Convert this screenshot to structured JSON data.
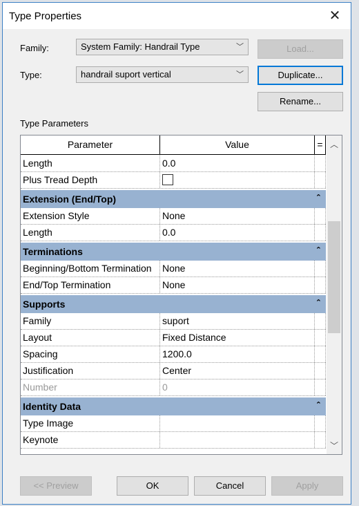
{
  "dialog": {
    "title": "Type Properties"
  },
  "family": {
    "label": "Family:",
    "value": "System Family: Handrail Type"
  },
  "type": {
    "label": "Type:",
    "value": "handrail suport vertical"
  },
  "buttons": {
    "load": "Load...",
    "duplicate": "Duplicate...",
    "rename": "Rename...",
    "preview": "<< Preview",
    "ok": "OK",
    "cancel": "Cancel",
    "apply": "Apply"
  },
  "section_label": "Type Parameters",
  "grid": {
    "headers": [
      "Parameter",
      "Value",
      "="
    ],
    "scroll_position_percent": 40,
    "rows": [
      {
        "kind": "row",
        "name": "Length",
        "value": "0.0"
      },
      {
        "kind": "row",
        "name": "Plus Tread Depth",
        "checkbox": false
      },
      {
        "kind": "group",
        "name": "Extension (End/Top)"
      },
      {
        "kind": "row",
        "name": "Extension Style",
        "value": "None"
      },
      {
        "kind": "row",
        "name": "Length",
        "value": "0.0"
      },
      {
        "kind": "group",
        "name": "Terminations"
      },
      {
        "kind": "row",
        "name": "Beginning/Bottom Termination",
        "value": "None"
      },
      {
        "kind": "row",
        "name": "End/Top Termination",
        "value": "None"
      },
      {
        "kind": "group",
        "name": "Supports"
      },
      {
        "kind": "row",
        "name": "Family",
        "value": "suport"
      },
      {
        "kind": "row",
        "name": "Layout",
        "value": "Fixed Distance"
      },
      {
        "kind": "row",
        "name": "Spacing",
        "value": "1200.0"
      },
      {
        "kind": "row",
        "name": "Justification",
        "value": "Center"
      },
      {
        "kind": "row",
        "name": "Number",
        "value": "0",
        "readonly": true
      },
      {
        "kind": "group",
        "name": "Identity Data"
      },
      {
        "kind": "row",
        "name": "Type Image",
        "value": ""
      },
      {
        "kind": "row",
        "name": "Keynote",
        "value": ""
      }
    ]
  },
  "colors": {
    "group_header": "#98b2d1",
    "focus": "#0078d7"
  }
}
